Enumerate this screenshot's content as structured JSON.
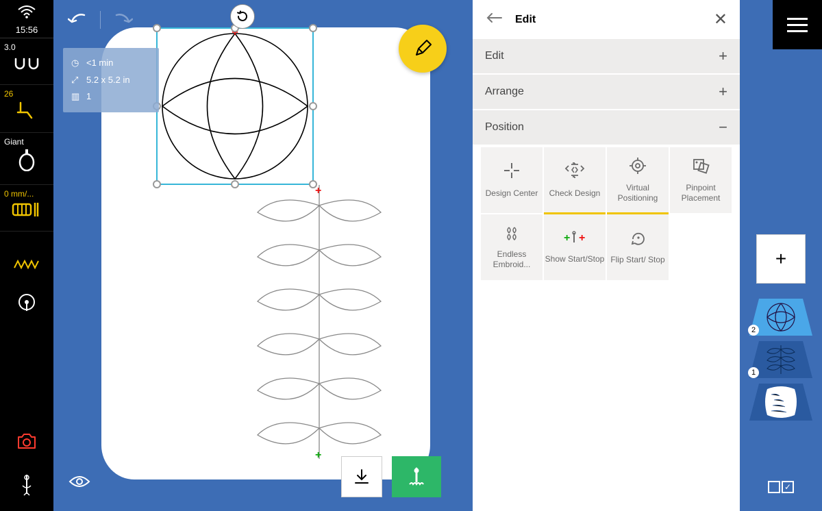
{
  "status": {
    "time": "15:56"
  },
  "left": {
    "tension": "3.0",
    "foot": "26",
    "hoop": "Giant",
    "speed": "0 mm/..."
  },
  "design": {
    "time": "<1 min",
    "size": "5.2 x 5.2 in",
    "colors": "1"
  },
  "panel": {
    "title": "Edit",
    "sections": {
      "edit": "Edit",
      "arrange": "Arrange",
      "position": "Position"
    },
    "tools": {
      "design_center": "Design Center",
      "check_design": "Check Design",
      "virtual_positioning": "Virtual Positioning",
      "pinpoint_placement": "Pinpoint Placement",
      "endless": "Endless Embroid...",
      "show_startstop": "Show Start/Stop",
      "flip_startstop": "Flip Start/ Stop"
    }
  },
  "layers": {
    "top_badge": "2",
    "bottom_badge": "1"
  }
}
